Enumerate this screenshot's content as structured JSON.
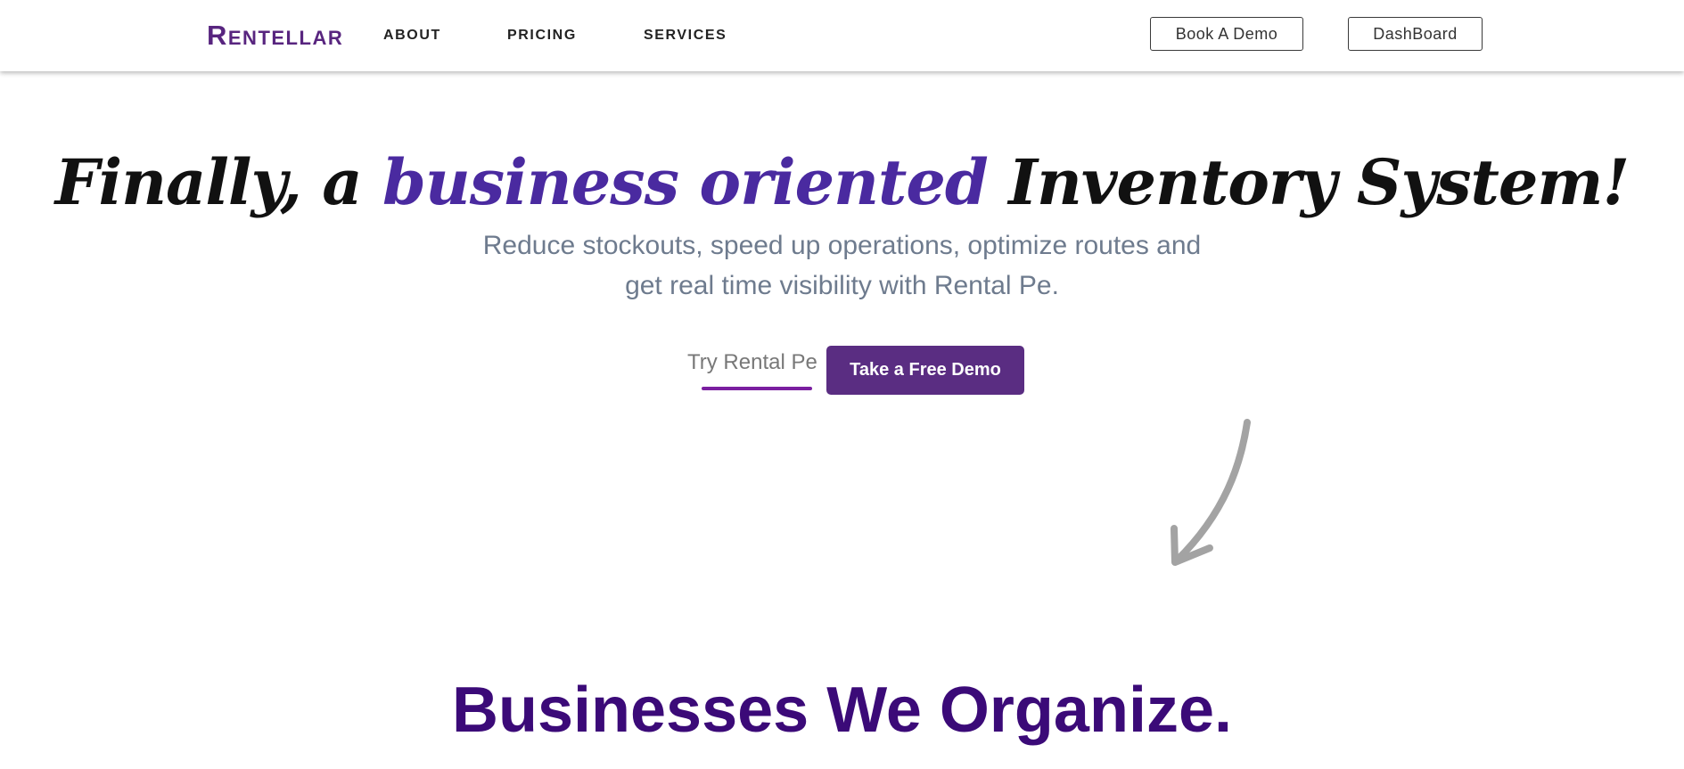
{
  "nav": {
    "logo": "Rentellar",
    "links": [
      "ABOUT",
      "PRICING",
      "SERVICES"
    ],
    "book_demo_label": "Book A Demo",
    "dashboard_label": "DashBoard"
  },
  "hero": {
    "title_part1": "Finally, a ",
    "title_accent": "business oriented",
    "title_part2": " Inventory System!",
    "subtitle_line1": "Reduce stockouts, speed up operations, optimize routes and",
    "subtitle_line2": "get real time visibility with Rental Pe.",
    "try_label": "Try Rental Pe",
    "demo_label": "Take a Free Demo"
  },
  "section": {
    "heading": "Businesses We Organize."
  },
  "icons": {
    "arrow": "curved-arrow-down-left-icon"
  },
  "colors": {
    "brand": "#58257f",
    "accent": "#4a2aa0",
    "button": "#5a2d82",
    "heading": "#3b0a78",
    "subtitle": "#6e7b8e"
  }
}
